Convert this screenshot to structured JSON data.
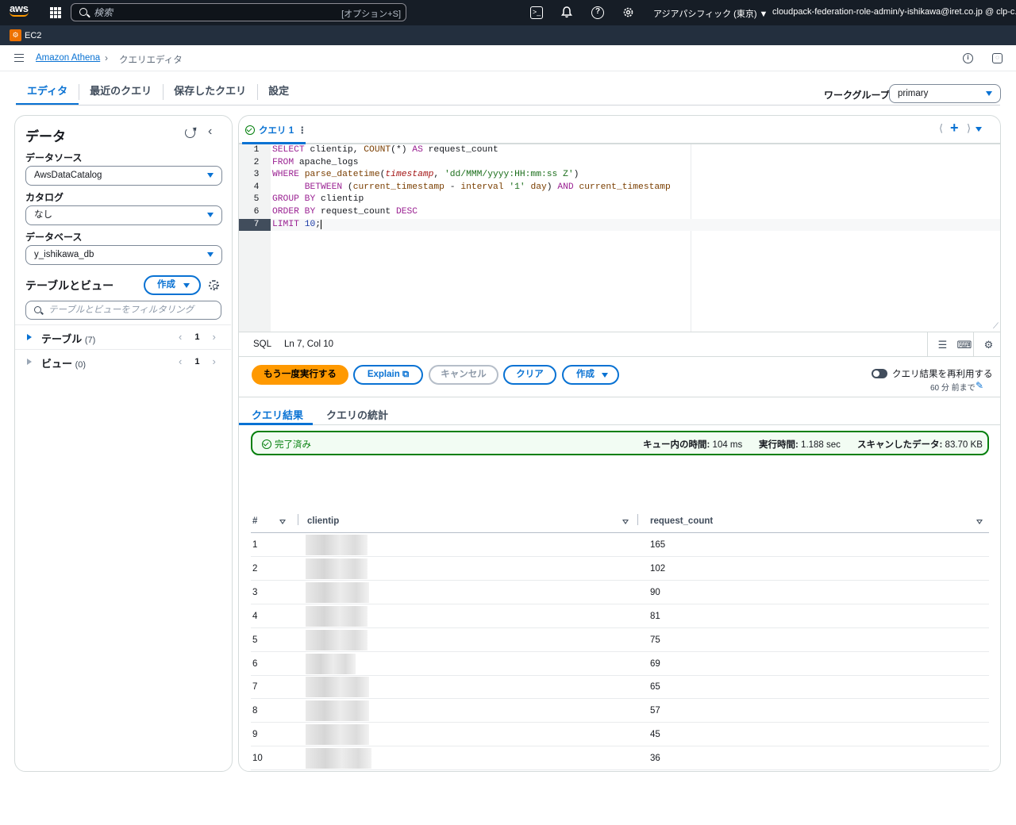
{
  "topbar": {
    "search_placeholder": "検索",
    "search_shortcut": "[オプション+S]",
    "region": "アジアパシフィック (東京) ▼",
    "account": "cloudpack-federation-role-admin/y-ishikawa@iret.co.jp @ clp-c..."
  },
  "subbar": {
    "service": "EC2"
  },
  "breadcrumb": {
    "home": "Amazon Athena",
    "current": "クエリエディタ"
  },
  "tabs": [
    "エディタ",
    "最近のクエリ",
    "保存したクエリ",
    "設定"
  ],
  "workgroup": {
    "label": "ワークグループ",
    "value": "primary"
  },
  "left": {
    "title": "データ",
    "datasource_label": "データソース",
    "datasource": "AwsDataCatalog",
    "catalog_label": "カタログ",
    "catalog": "なし",
    "database_label": "データベース",
    "database": "y_ishikawa_db",
    "tables_title": "テーブルとビュー",
    "create": "作成",
    "filter_placeholder": "テーブルとビューをフィルタリング",
    "tree": [
      {
        "name": "テーブル",
        "count": "(7)",
        "page": "1"
      },
      {
        "name": "ビュー",
        "count": "(0)",
        "page": "1"
      }
    ]
  },
  "query_tab": "クエリ 1",
  "editor": {
    "line_numbers": [
      "1",
      "2",
      "3",
      "4",
      "5",
      "6",
      "7"
    ],
    "language": "SQL",
    "position": "Ln 7, Col 10"
  },
  "actions": {
    "rerun": "もう一度実行する",
    "explain": "Explain",
    "cancel": "キャンセル",
    "clear": "クリア",
    "create": "作成",
    "reuse": "クエリ結果を再利用する",
    "reuse_sub": "60 分 前まで"
  },
  "result_tabs": [
    "クエリ結果",
    "クエリの統計"
  ],
  "status": {
    "state": "完了済み",
    "queue_label": "キュー内の時間:",
    "queue_value": "104 ms",
    "exec_label": "実行時間:",
    "exec_value": "1.188 sec",
    "scan_label": "スキャンしたデータ:",
    "scan_value": "83.70 KB"
  },
  "table": {
    "columns": [
      "#",
      "clientip",
      "request_count"
    ],
    "rows": [
      {
        "n": "1",
        "count": "165",
        "blur": 78
      },
      {
        "n": "2",
        "count": "102",
        "blur": 78
      },
      {
        "n": "3",
        "count": "90",
        "blur": 80
      },
      {
        "n": "4",
        "count": "81",
        "blur": 78
      },
      {
        "n": "5",
        "count": "75",
        "blur": 78
      },
      {
        "n": "6",
        "count": "69",
        "blur": 63
      },
      {
        "n": "7",
        "count": "65",
        "blur": 80
      },
      {
        "n": "8",
        "count": "57",
        "blur": 80
      },
      {
        "n": "9",
        "count": "45",
        "blur": 80
      },
      {
        "n": "10",
        "count": "36",
        "blur": 83
      }
    ]
  }
}
